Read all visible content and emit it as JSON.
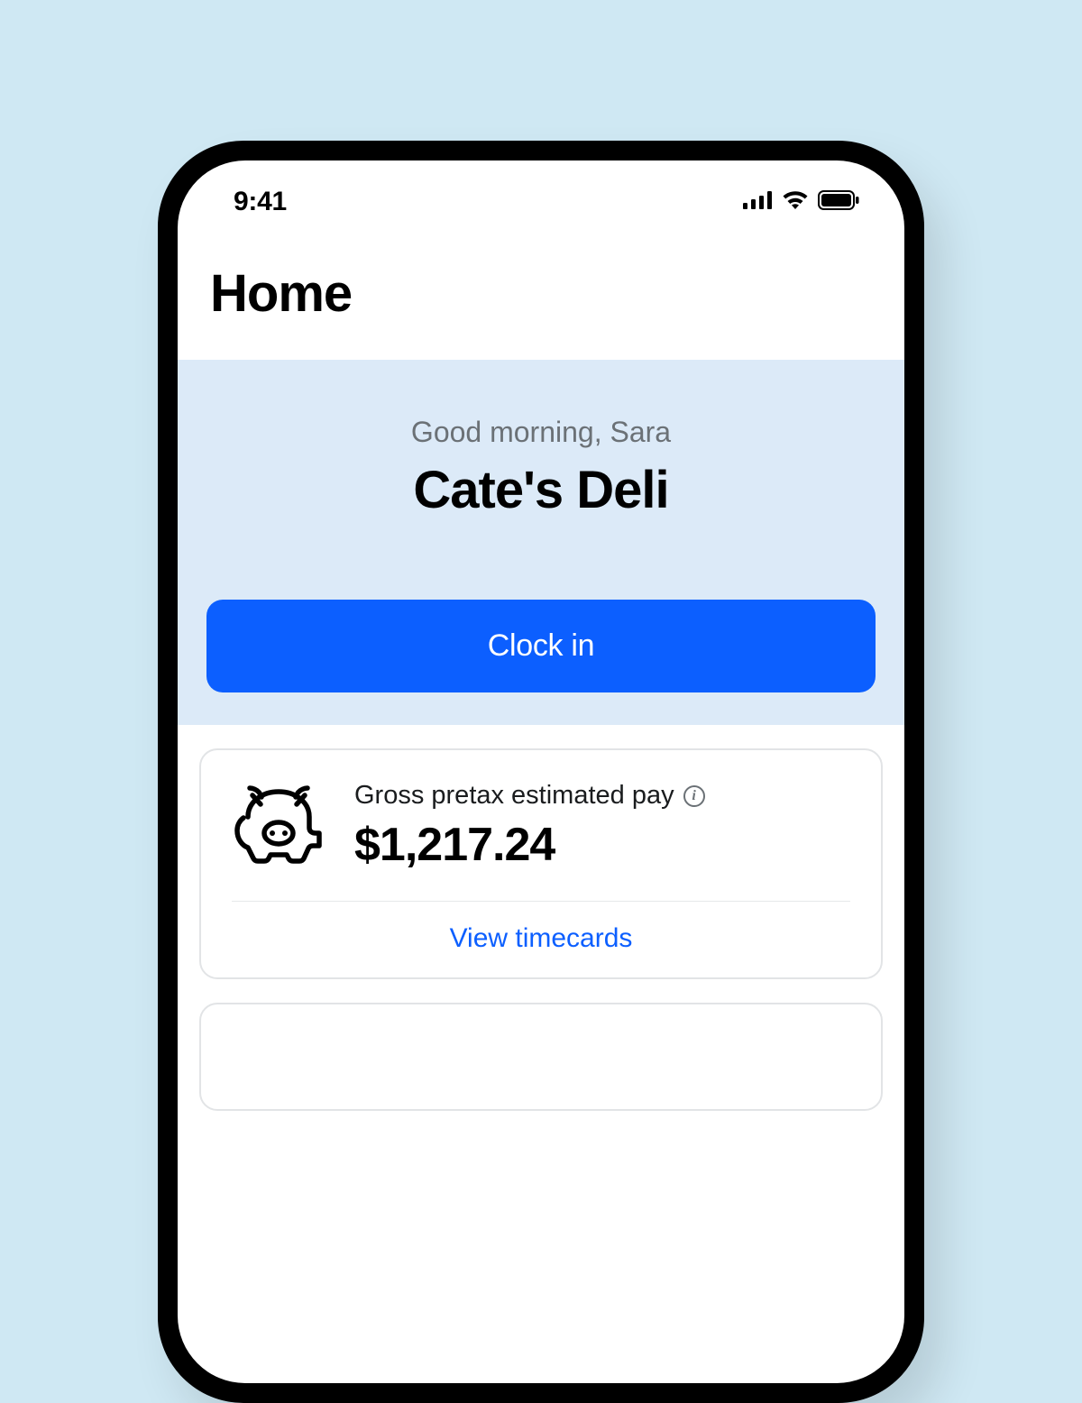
{
  "status_bar": {
    "time": "9:41",
    "signal_icon": "cellular-signal-icon",
    "wifi_icon": "wifi-icon",
    "battery_icon": "battery-icon"
  },
  "header": {
    "title": "Home"
  },
  "hero": {
    "greeting": "Good morning, Sara",
    "workplace_name": "Cate's Deli",
    "clock_in_label": "Clock in"
  },
  "pay_card": {
    "icon": "piggy-bank-icon",
    "label": "Gross pretax estimated pay",
    "info_icon": "info-icon",
    "amount": "$1,217.24",
    "link_label": "View timecards"
  },
  "colors": {
    "accent": "#0c5fff",
    "hero_bg": "#dceaf8",
    "page_bg": "#cfe8f3",
    "secondary_text": "#6b7176"
  }
}
